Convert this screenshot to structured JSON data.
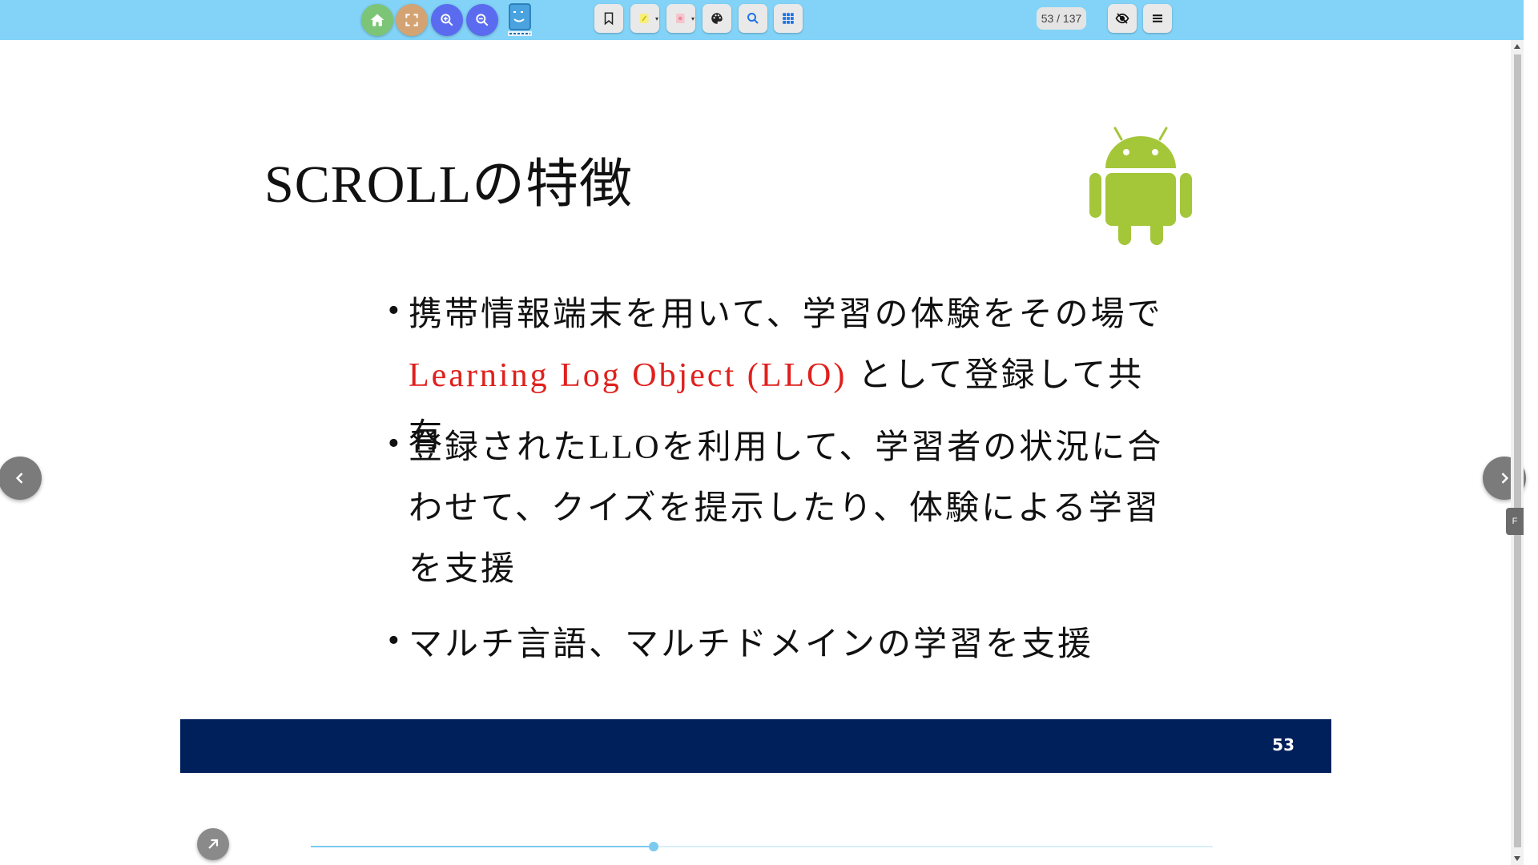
{
  "toolbar": {
    "buttons": [
      {
        "name": "home",
        "icon": "home-icon",
        "color": "#7cc576"
      },
      {
        "name": "fullscreen",
        "icon": "fullscreen-icon",
        "color": "#d4a373"
      },
      {
        "name": "zoom-in",
        "icon": "zoom-in-icon",
        "color": "#5a6bf0"
      },
      {
        "name": "zoom-out",
        "icon": "zoom-out-icon",
        "color": "#5a6bf0"
      }
    ],
    "tools": [
      "bookmark-icon",
      "highlighter-icon",
      "eraser-icon",
      "palette-icon",
      "search-icon",
      "grid-icon"
    ],
    "page_indicator": "53 / 137",
    "right_buttons": [
      "hide-icon",
      "menu-icon"
    ]
  },
  "slide": {
    "title": "SCROLLの特徴",
    "bullets": [
      {
        "parts": [
          {
            "text": "携帯情報端末を用いて、学習の体験をその場で"
          },
          {
            "text": "Learning Log Object (LLO)",
            "color": "#e0201c"
          },
          {
            "text": " として登録して共有"
          }
        ]
      },
      {
        "parts": [
          {
            "text": "登録されたLLOを利用して、学習者の状況に合わせて、クイズを提示したり、体験による学習を支援"
          }
        ]
      },
      {
        "parts": [
          {
            "text": "マルチ言語、マルチドメインの学習を支援"
          }
        ]
      }
    ],
    "slide_number": "53",
    "footer_color": "#00205b"
  },
  "side_tab": "F",
  "progress": {
    "current": 53,
    "total": 137,
    "fraction": 0.38
  }
}
